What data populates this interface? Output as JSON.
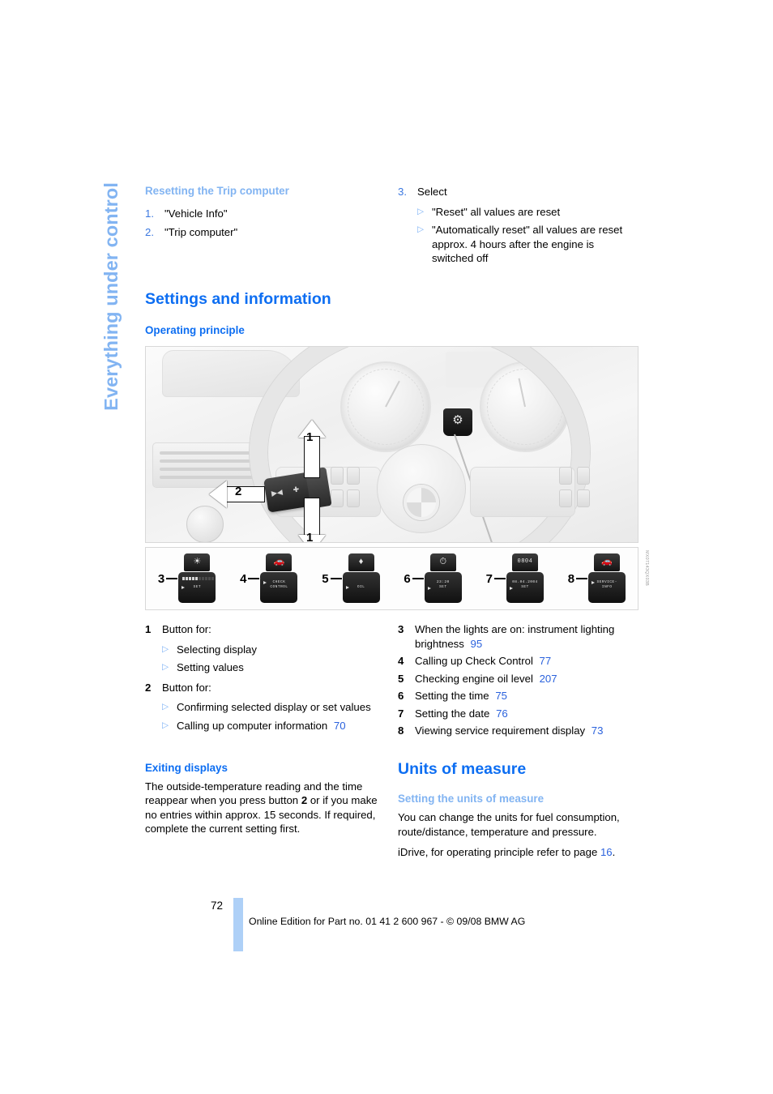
{
  "chapter_tab": {
    "label": "Everything under control"
  },
  "top_left": {
    "heading": "Resetting the Trip computer",
    "steps": [
      {
        "num": "1.",
        "text": "\"Vehicle Info\""
      },
      {
        "num": "2.",
        "text": "\"Trip computer\""
      }
    ]
  },
  "top_right": {
    "step_num": "3.",
    "step_text": "Select",
    "bullets": [
      "\"Reset\" all values are reset",
      "\"Automatically reset\" all values are reset approx. 4 hours after the engine is switched off"
    ]
  },
  "section_settings": {
    "title": "Settings and information",
    "subtitle": "Operating principle"
  },
  "figure": {
    "code": "MX07143QX03B",
    "callouts": [
      {
        "num": "1",
        "direction": "up"
      },
      {
        "num": "1",
        "direction": "down"
      },
      {
        "num": "2",
        "direction": "left"
      }
    ],
    "hud_icon": "service-indicator-icon",
    "strip": [
      {
        "num": "3",
        "icon": "brightness-sun-icon",
        "display_line1": "",
        "display_line2": "SET",
        "has_segments": true
      },
      {
        "num": "4",
        "icon": "car-silhouette-icon",
        "display_line1": "CHECK",
        "display_line2": "CONTROL",
        "has_segments": false
      },
      {
        "num": "5",
        "icon": "oil-can-icon",
        "display_line1": "OIL",
        "display_line2": "",
        "has_segments": false
      },
      {
        "num": "6",
        "icon": "clock-icon",
        "display_line1": "23:20",
        "display_line2": "SET",
        "has_segments": false
      },
      {
        "num": "7",
        "icon": "date-display-icon",
        "display_line1": "08.04.2004",
        "display_line2": "SET",
        "has_segments": false
      },
      {
        "num": "8",
        "icon": "car-service-icon",
        "display_line1": "SERVICE-",
        "display_line2": "INFO",
        "has_segments": false
      }
    ]
  },
  "legend_left": [
    {
      "num": "1",
      "title": "Button for:",
      "bullets": [
        {
          "text": "Selecting display",
          "page": ""
        },
        {
          "text": "Setting values",
          "page": ""
        }
      ]
    },
    {
      "num": "2",
      "title": "Button for:",
      "bullets": [
        {
          "text": "Confirming selected display or set values",
          "page": ""
        },
        {
          "text": "Calling up computer information",
          "page": "70"
        }
      ]
    }
  ],
  "legend_right": [
    {
      "num": "3",
      "text": "When the lights are on: instrument lighting brightness",
      "page": "95"
    },
    {
      "num": "4",
      "text": "Calling up Check Control",
      "page": "77"
    },
    {
      "num": "5",
      "text": "Checking engine oil level",
      "page": "207"
    },
    {
      "num": "6",
      "text": "Setting the time",
      "page": "75"
    },
    {
      "num": "7",
      "text": "Setting the date",
      "page": "76"
    },
    {
      "num": "8",
      "text": "Viewing service requirement display",
      "page": "73"
    }
  ],
  "exiting_displays": {
    "heading": "Exiting displays",
    "para_a": "The outside-temperature reading and the time reappear when you press button ",
    "para_bold": "2",
    "para_b": " or if you make no entries within approx. 15 seconds. If required, complete the current setting first."
  },
  "units_of_measure": {
    "title": "Units of measure",
    "subtitle": "Setting the units of measure",
    "para1": "You can change the units for fuel consumption, route/distance, temperature and pressure.",
    "para2_a": "iDrive, for operating principle refer to page ",
    "para2_page": "16",
    "para2_b": "."
  },
  "footer": {
    "page_number": "72",
    "text": "Online Edition for Part no. 01 41 2 600 967  - © 09/08 BMW AG"
  },
  "colors": {
    "heading_blue": "#0d6ef2",
    "light_blue": "#82b4f2",
    "page_ref_blue": "#2b62dd",
    "footer_bar": "#aed0f7"
  }
}
